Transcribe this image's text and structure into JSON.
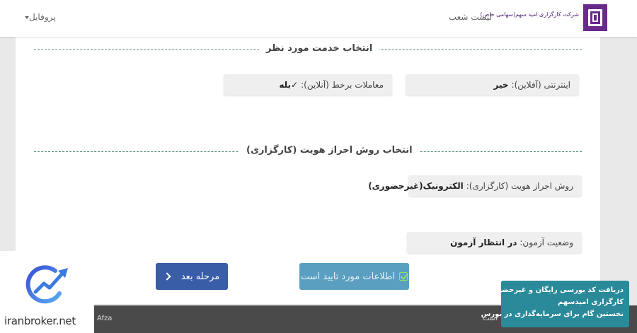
{
  "header": {
    "company_name": "شرکت کارگزاری امید سهم(سهامی خاص)",
    "branches_link": "لیست شعب",
    "profile_menu": "پروفایل"
  },
  "service_section": {
    "title": "انتخاب خدمت مورد نظر",
    "internet_label": "اینترنتی (آفلاین):",
    "internet_value": "خیر",
    "online_label": "معاملات برخط (آنلاین):",
    "online_value": "✓بله"
  },
  "auth_section": {
    "title": "انتخاب روش احراز هویت (کارگزاری)",
    "method_label": "روش احراز هویت (کارگزاری):",
    "method_value": "الکترونیک(غیرحضوری)",
    "exam_label": "وضعیت آزمون:",
    "exam_value": "در انتظار آزمون"
  },
  "actions": {
    "next_label": "مرحله بعد",
    "confirm_label": "اطلاعات مورد تایید است"
  },
  "footer": {
    "left_text": "Afza",
    "right_text": "است"
  },
  "watermark": {
    "brand_text": "iranbroker.net"
  },
  "promo": {
    "line1": "دریافت کد بورسی رایگان و غیرحضوری |",
    "line2": "کارگزاری امیدسهم",
    "line3": "نخستین گام برای سرمایه‌گذاری در بورس"
  },
  "colors": {
    "logo_purple": "#6a2a8a",
    "primary_button": "#3a5da8",
    "confirm_button": "#5a9fbf",
    "divider": "#5a8a84",
    "footer": "#4a4a4a",
    "promo_banner": "#2a8a9a"
  },
  "icons": {
    "logo": "company-logo-icon",
    "next": "chevron-right-icon",
    "confirm": "check-square-icon",
    "profile_caret": "caret-down-icon"
  }
}
